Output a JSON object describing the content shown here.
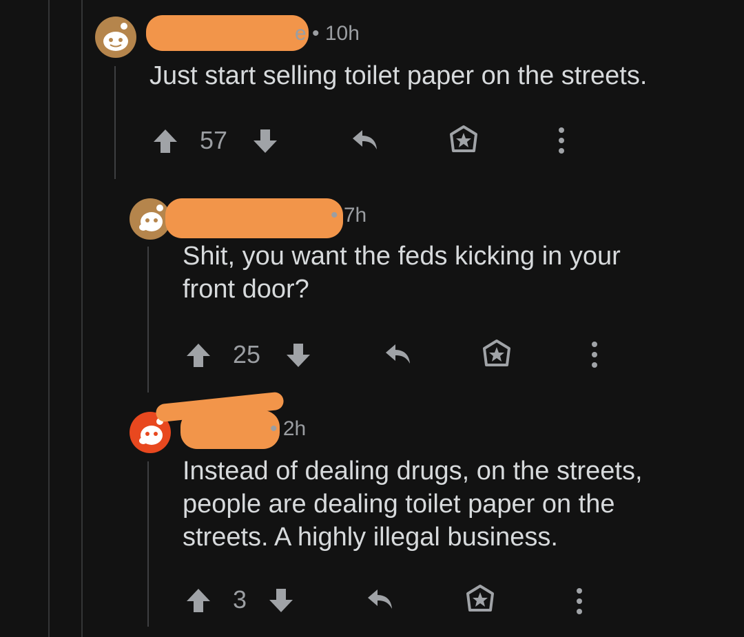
{
  "colors": {
    "background": "#121212",
    "text": "#d7dadc",
    "muted": "#9b9ea2",
    "redaction": "#f2954a",
    "avatar_orange": "#e8481f",
    "avatar_tan": "#b5854c"
  },
  "comments": [
    {
      "username_fragment": "e",
      "time": "10h",
      "body": "Just start selling toilet paper on the streets.",
      "score": "57",
      "avatar": "snoo-avatar-tan"
    },
    {
      "username_fragment": "",
      "time": "7h",
      "body": "Shit, you want the feds kicking in your front door?",
      "score": "25",
      "avatar": "snoo-avatar-tan"
    },
    {
      "username_fragment": "",
      "time": "2h",
      "body": "Instead of dealing drugs, on the streets, people are dealing toilet paper on the streets. A highly illegal business.",
      "score": "3",
      "avatar": "snoo-avatar-orange"
    }
  ],
  "icons": {
    "upvote": "upvote-arrow-icon",
    "downvote": "downvote-arrow-icon",
    "reply": "reply-arrow-icon",
    "award": "award-icon",
    "more": "more-options-icon"
  }
}
